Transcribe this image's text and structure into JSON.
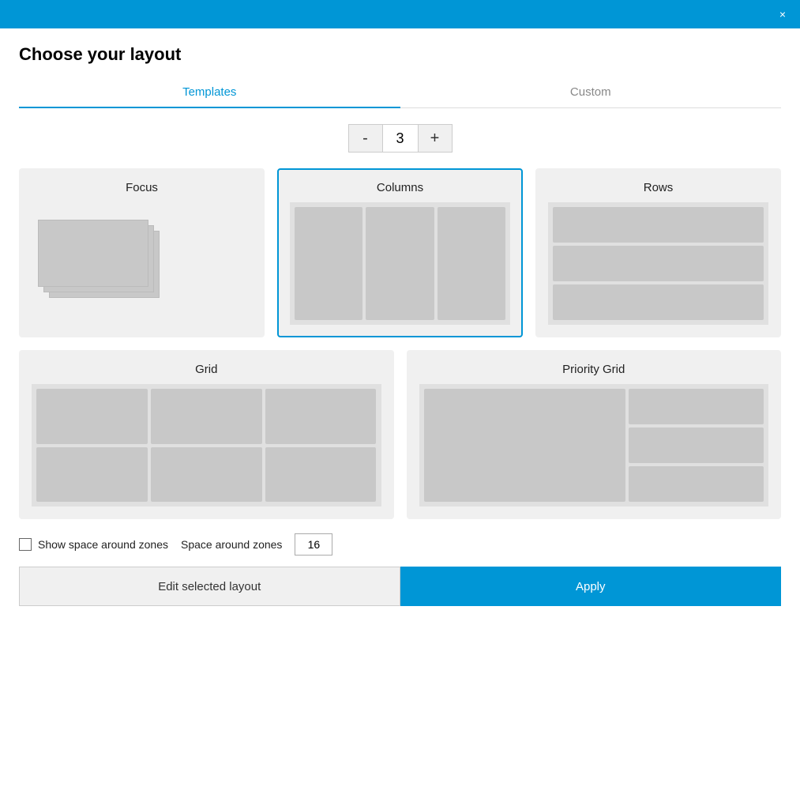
{
  "titleBar": {
    "closeIcon": "×"
  },
  "dialog": {
    "title": "Choose your layout"
  },
  "tabs": [
    {
      "label": "Templates",
      "active": true
    },
    {
      "label": "Custom",
      "active": false
    }
  ],
  "counter": {
    "decrementLabel": "-",
    "value": "3",
    "incrementLabel": "+"
  },
  "layouts": [
    {
      "id": "focus",
      "label": "Focus",
      "selected": false
    },
    {
      "id": "columns",
      "label": "Columns",
      "selected": true
    },
    {
      "id": "rows",
      "label": "Rows",
      "selected": false
    },
    {
      "id": "grid",
      "label": "Grid",
      "selected": false
    },
    {
      "id": "priority-grid",
      "label": "Priority Grid",
      "selected": false
    }
  ],
  "spaceZone": {
    "checkboxLabel": "Show space around zones",
    "spaceLabel": "Space around zones",
    "spaceValue": "16"
  },
  "footer": {
    "editLabel": "Edit selected layout",
    "applyLabel": "Apply"
  }
}
